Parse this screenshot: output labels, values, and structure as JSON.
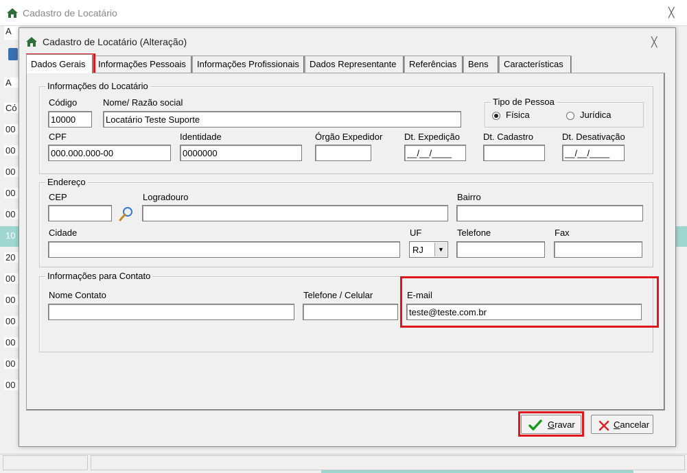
{
  "background_window": {
    "title": "Cadastro de Locatário",
    "edge_fragments": [
      "A",
      "Cό",
      "00",
      "00",
      "00",
      "00",
      "00",
      "10",
      "20",
      "00",
      "00",
      "00",
      "00",
      "00",
      "00",
      "Cό",
      "A"
    ]
  },
  "dialog": {
    "title": "Cadastro de Locatário (Alteração)",
    "tabs": [
      {
        "label": "Dados Gerais",
        "active": true
      },
      {
        "label": "Informações Pessoais"
      },
      {
        "label": "Informações Profissionais"
      },
      {
        "label": "Dados Representante"
      },
      {
        "label": "Referências"
      },
      {
        "label": "Bens"
      },
      {
        "label": "Características"
      }
    ],
    "info_locatario": {
      "title": "Informações do Locatário",
      "codigo_label": "Código",
      "codigo_value": "10000",
      "nome_label": "Nome/ Razão social",
      "nome_value": "Locatário Teste Suporte",
      "tipo_pessoa_title": "Tipo de Pessoa",
      "fisica_label": "Física",
      "juridica_label": "Jurídica",
      "tipo_selected": "Física",
      "cpf_label": "CPF",
      "cpf_value": "000.000.000-00",
      "identidade_label": "Identidade",
      "identidade_value": "0000000",
      "orgao_label": "Órgão Expedidor",
      "orgao_value": "",
      "dt_expedicao_label": "Dt. Expedição",
      "dt_expedicao_value": "__/__/____",
      "dt_cadastro_label": "Dt. Cadastro",
      "dt_cadastro_value": "",
      "dt_desativacao_label": "Dt. Desativação",
      "dt_desativacao_value": "__/__/____"
    },
    "endereco": {
      "title": "Endereço",
      "cep_label": "CEP",
      "cep_value": "",
      "logradouro_label": "Logradouro",
      "logradouro_value": "",
      "bairro_label": "Bairro",
      "bairro_value": "",
      "cidade_label": "Cidade",
      "cidade_value": "",
      "uf_label": "UF",
      "uf_value": "RJ",
      "telefone_label": "Telefone",
      "telefone_value": "",
      "fax_label": "Fax",
      "fax_value": ""
    },
    "contato": {
      "title": "Informações para Contato",
      "nome_label": "Nome Contato",
      "nome_value": "",
      "telefone_label": "Telefone / Celular",
      "telefone_value": "",
      "email_label": "E-mail",
      "email_value": "teste@teste.com.br"
    },
    "buttons": {
      "gravar_first": "G",
      "gravar_rest": "ravar",
      "cancelar_first": "C",
      "cancelar_rest": "ancelar"
    }
  },
  "colors": {
    "highlight_red": "#e0161f",
    "window_bg": "#f0f0f0",
    "selected_row": "#9fd7cf",
    "check_green": "#1a9a1a",
    "cancel_red": "#e02020",
    "home_green": "#2f6e3b"
  },
  "icons": {
    "home": "home-icon",
    "close": "close-icon",
    "search": "magnifier-icon",
    "dropdown": "chevron-down-icon",
    "gravar": "checkmark-icon",
    "cancelar": "x-icon"
  }
}
